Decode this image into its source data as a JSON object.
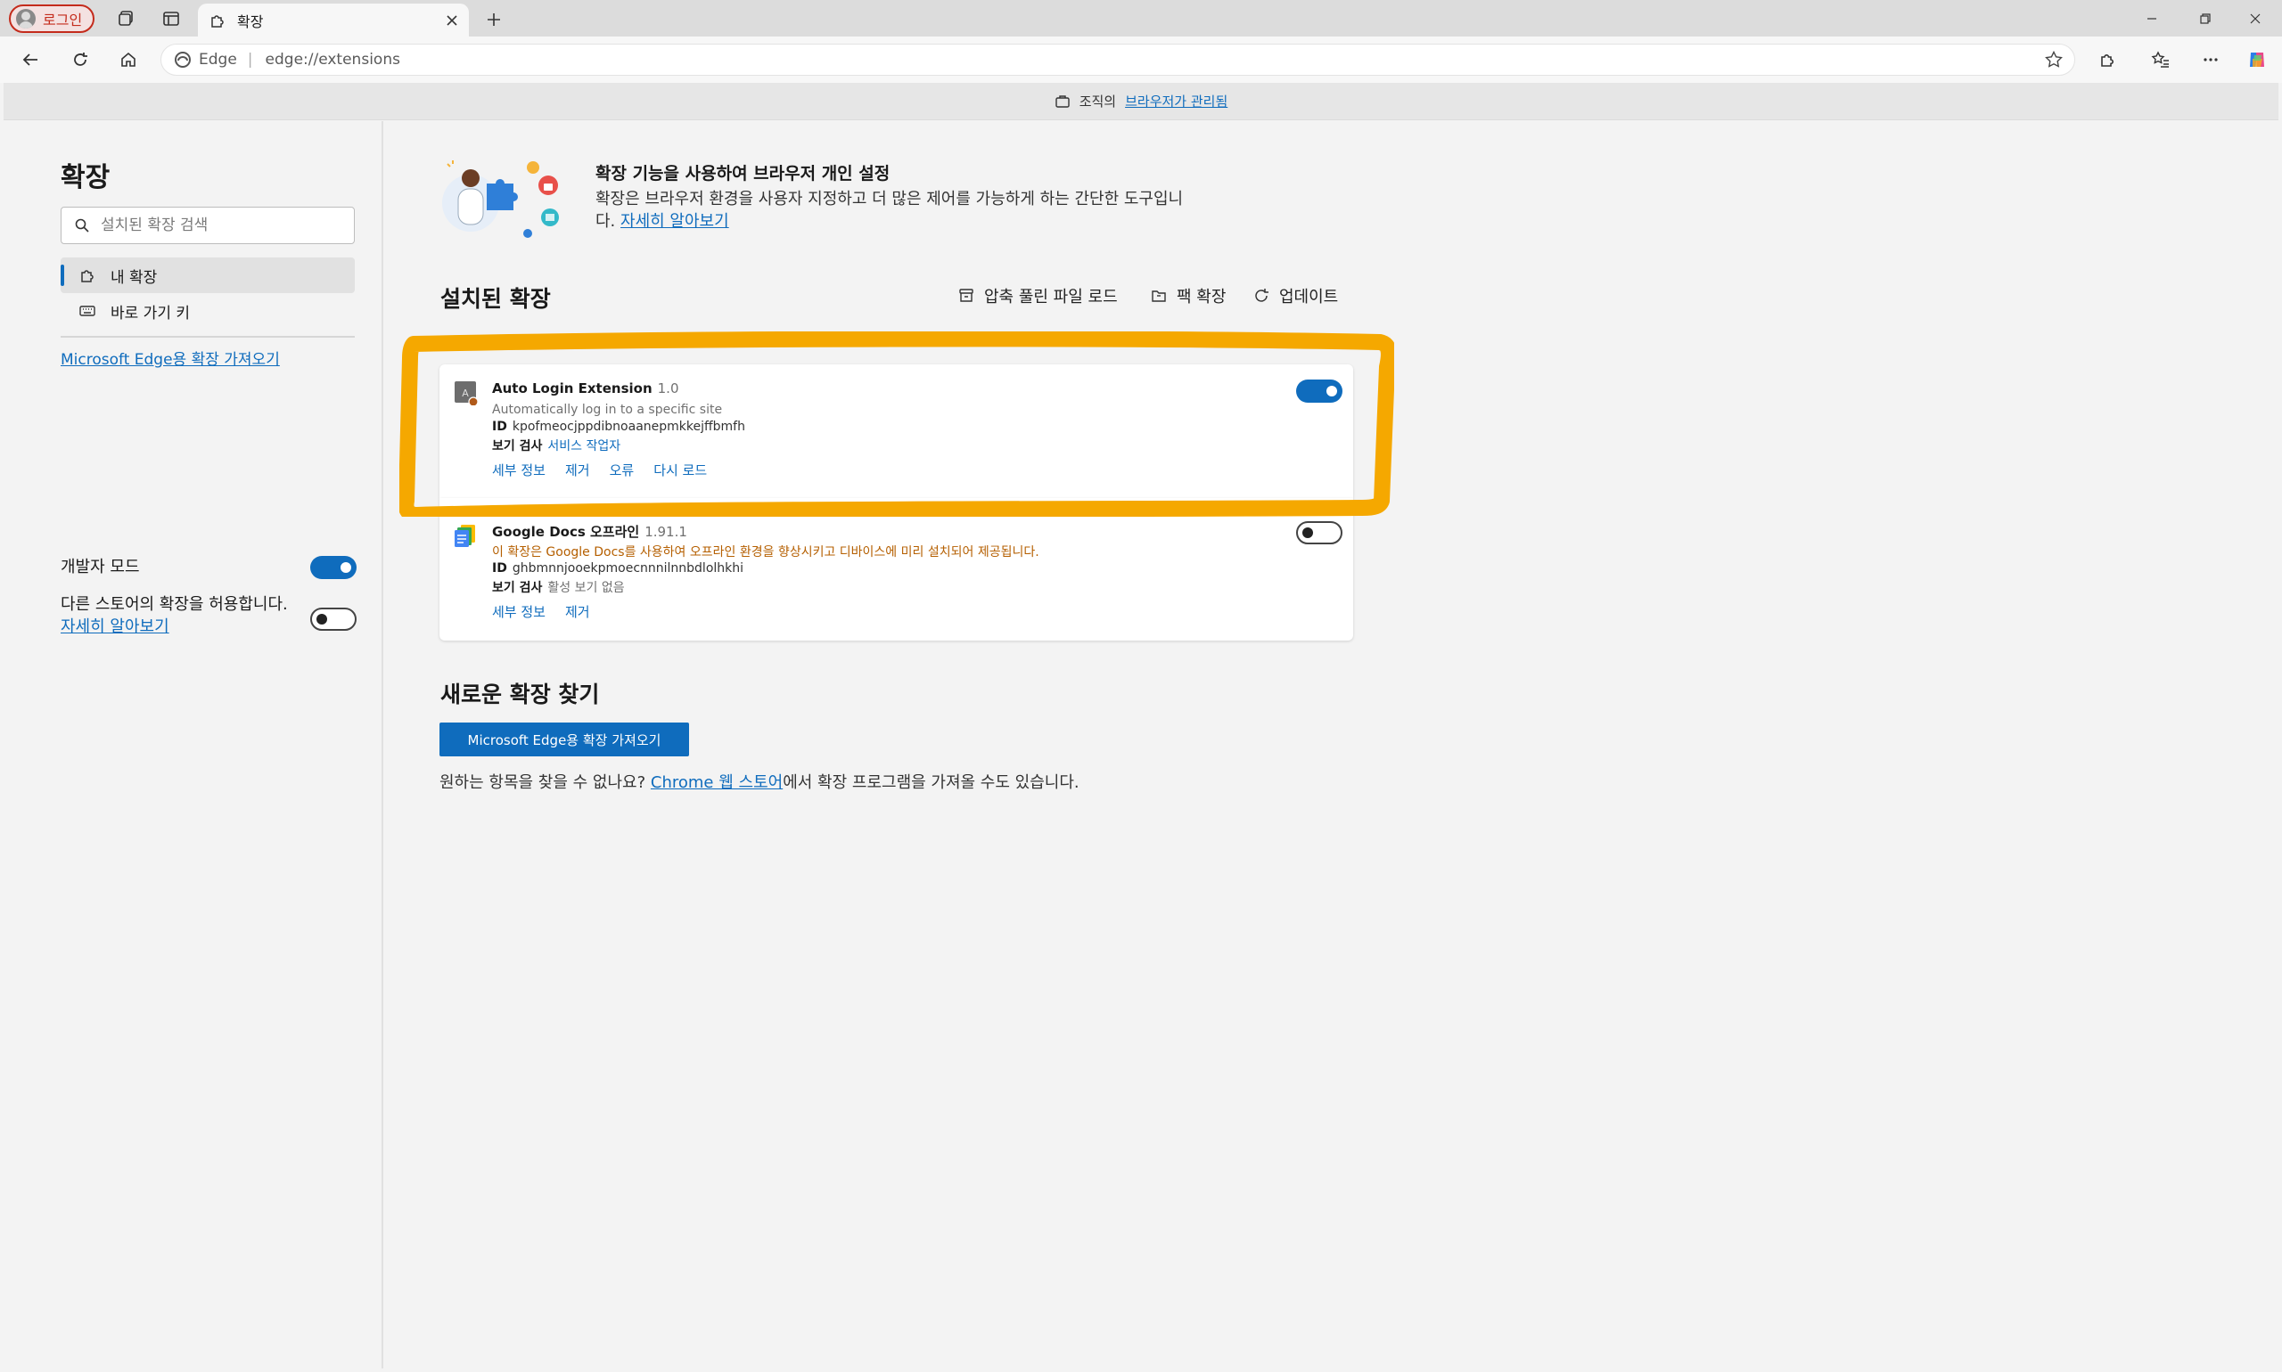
{
  "tabstrip": {
    "profile_label": "로그인",
    "active_tab_title": "확장"
  },
  "toolbar": {
    "address_brand": "Edge",
    "address_url": "edge://extensions"
  },
  "banner": {
    "prefix": "조직의",
    "link": "브라우저가 관리됨"
  },
  "sidebar": {
    "title": "확장",
    "search_placeholder": "설치된 확장 검색",
    "nav": [
      {
        "label": "내 확장",
        "icon": "puzzle-icon",
        "selected": true
      },
      {
        "label": "바로 가기 키",
        "icon": "keyboard-icon",
        "selected": false
      }
    ],
    "store_link": "Microsoft Edge용 확장 가져오기",
    "dev_mode_label": "개발자 모드",
    "dev_mode_on": true,
    "other_store_label": "다른 스토어의 확장을 허용합니다.",
    "other_store_link": "자세히 알아보기",
    "other_store_on": false
  },
  "hero": {
    "title": "확장 기능을 사용하여 브라우저 개인 설정",
    "desc": "확장은 브라우저 환경을 사용자 지정하고 더 많은 제어를 가능하게 하는 간단한 도구입니다.",
    "link": "자세히 알아보기"
  },
  "installed": {
    "title": "설치된 확장",
    "actions": {
      "load_unpacked": "압축 풀린 파일 로드",
      "pack": "팩 확장",
      "update": "업데이트"
    }
  },
  "extensions": [
    {
      "name": "Auto Login Extension",
      "version": "1.0",
      "description": "Automatically log in to a specific site",
      "id_label": "ID",
      "id": "kpofmeocjppdibnoaanepmkkejffbmfh",
      "inspect_label": "보기 검사",
      "inspect_value": "서비스 작업자",
      "actions": [
        "세부 정보",
        "제거",
        "오류",
        "다시 로드"
      ],
      "enabled": true
    },
    {
      "name": "Google Docs 오프라인",
      "version": "1.91.1",
      "description": "이 확장은 Google Docs를 사용하여 오프라인 환경을 향상시키고 디바이스에 미리 설치되어 제공됩니다.",
      "id_label": "ID",
      "id": "ghbmnnjooekpmoecnnnilnnbdlolhkhi",
      "inspect_label": "보기 검사",
      "inspect_value": "활성 보기 없음",
      "actions": [
        "세부 정보",
        "제거"
      ],
      "enabled": false
    }
  ],
  "find": {
    "title": "새로운 확장 찾기",
    "button": "Microsoft Edge용 확장 가져오기",
    "desc_prefix": "원하는 항목을 찾을 수 없나요?",
    "desc_link": "Chrome 웹 스토어",
    "desc_suffix": "에서 확장 프로그램을 가져올 수도 있습니다."
  },
  "colors": {
    "accent": "#0f6cbd",
    "highlight": "#f5a800",
    "warning_text": "#b55f00"
  }
}
